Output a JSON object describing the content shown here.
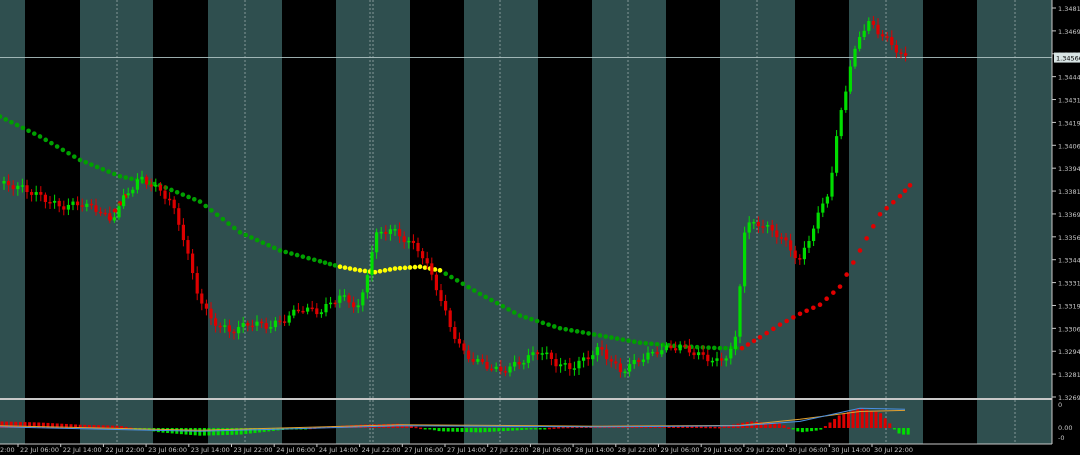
{
  "chart_data": {
    "type": "candlestick",
    "title": "",
    "price_axis": {
      "ticks": [
        "1.34815",
        "1.34690",
        "1.34565",
        "1.34440",
        "1.34315",
        "1.34190",
        "1.34065",
        "1.33940",
        "1.33815",
        "1.33690",
        "1.33565",
        "1.33440",
        "1.33315",
        "1.33190",
        "1.33065",
        "1.32940",
        "1.32815",
        "1.32690"
      ],
      "ylim": [
        1.3269,
        1.3484
      ],
      "current_price": "1.34566"
    },
    "time_axis": {
      "labels": [
        "22 Jul 06:00",
        "22 Jul 14:00",
        "22 Jul 22:00",
        "23 Jul 06:00",
        "23 Jul 14:00",
        "23 Jul 22:00",
        "24 Jul 06:00",
        "24 Jul 14:00",
        "24 Jul 22:00",
        "27 Jul 06:00",
        "27 Jul 14:00",
        "27 Jul 22:00",
        "28 Jul 06:00",
        "28 Jul 14:00",
        "28 Jul 22:00",
        "29 Jul 06:00",
        "29 Jul 14:00",
        "29 Jul 22:00",
        "30 Jul 06:00",
        "30 Jul 14:00",
        "30 Jul 22:00"
      ],
      "partial_label": "2:00"
    },
    "price_points": [
      [
        0,
        1.3387
      ],
      [
        20,
        1.3385
      ],
      [
        40,
        1.338
      ],
      [
        60,
        1.3374
      ],
      [
        80,
        1.3376
      ],
      [
        100,
        1.3372
      ],
      [
        110,
        1.3366
      ],
      [
        125,
        1.338
      ],
      [
        140,
        1.339
      ],
      [
        155,
        1.3385
      ],
      [
        170,
        1.3378
      ],
      [
        185,
        1.3355
      ],
      [
        195,
        1.333
      ],
      [
        210,
        1.3312
      ],
      [
        230,
        1.3305
      ],
      [
        250,
        1.331
      ],
      [
        270,
        1.3308
      ],
      [
        285,
        1.3312
      ],
      [
        300,
        1.3318
      ],
      [
        320,
        1.3316
      ],
      [
        340,
        1.3325
      ],
      [
        360,
        1.3318
      ],
      [
        375,
        1.3358
      ],
      [
        390,
        1.3362
      ],
      [
        405,
        1.3356
      ],
      [
        420,
        1.335
      ],
      [
        435,
        1.3332
      ],
      [
        450,
        1.3308
      ],
      [
        465,
        1.3292
      ],
      [
        480,
        1.3288
      ],
      [
        500,
        1.3283
      ],
      [
        520,
        1.3288
      ],
      [
        540,
        1.3295
      ],
      [
        555,
        1.3288
      ],
      [
        570,
        1.3285
      ],
      [
        585,
        1.329
      ],
      [
        600,
        1.3296
      ],
      [
        620,
        1.3283
      ],
      [
        640,
        1.329
      ],
      [
        660,
        1.3295
      ],
      [
        680,
        1.3297
      ],
      [
        700,
        1.3292
      ],
      [
        720,
        1.3288
      ],
      [
        735,
        1.3298
      ],
      [
        745,
        1.3364
      ],
      [
        760,
        1.3365
      ],
      [
        780,
        1.3358
      ],
      [
        800,
        1.3344
      ],
      [
        815,
        1.3365
      ],
      [
        830,
        1.3385
      ],
      [
        840,
        1.3425
      ],
      [
        850,
        1.345
      ],
      [
        860,
        1.347
      ],
      [
        870,
        1.3476
      ],
      [
        880,
        1.347
      ],
      [
        895,
        1.3462
      ],
      [
        905,
        1.3456
      ]
    ],
    "candle_bias": [
      0,
      1,
      0,
      0,
      1,
      1,
      0,
      1,
      0,
      0,
      1,
      0,
      1,
      1,
      0,
      0,
      1,
      0,
      1,
      1,
      0,
      1,
      0,
      0,
      1,
      1,
      0,
      1,
      0,
      1,
      0,
      0,
      1,
      0,
      1,
      1,
      0,
      0,
      1,
      0,
      1,
      0,
      1,
      1,
      0,
      1,
      0,
      0,
      1,
      0,
      1,
      1,
      0,
      0,
      1,
      0,
      1,
      0,
      0,
      1,
      1,
      0,
      1,
      0,
      1,
      0,
      0,
      1,
      1,
      0,
      1,
      0,
      1,
      0,
      0,
      1,
      0,
      1,
      1,
      0,
      1,
      0,
      0,
      1,
      1,
      0,
      1,
      0,
      1,
      0,
      0,
      1,
      1,
      0,
      1,
      0,
      1,
      1,
      0,
      0
    ],
    "moving_average_green": [
      [
        0,
        1.3424
      ],
      [
        40,
        1.3413
      ],
      [
        80,
        1.34
      ],
      [
        120,
        1.3391
      ],
      [
        160,
        1.3386
      ],
      [
        200,
        1.3377
      ],
      [
        240,
        1.336
      ],
      [
        280,
        1.335
      ],
      [
        320,
        1.3344
      ],
      [
        340,
        1.3341
      ]
    ],
    "moving_average_yellow": [
      [
        340,
        1.3341
      ],
      [
        360,
        1.3339
      ],
      [
        375,
        1.3338
      ],
      [
        395,
        1.334
      ],
      [
        420,
        1.3341
      ],
      [
        440,
        1.3339
      ]
    ],
    "moving_average_green_2": [
      [
        440,
        1.3339
      ],
      [
        480,
        1.3326
      ],
      [
        520,
        1.3314
      ],
      [
        560,
        1.3307
      ],
      [
        600,
        1.3303
      ],
      [
        640,
        1.3299
      ],
      [
        680,
        1.3297
      ],
      [
        720,
        1.3296
      ],
      [
        742,
        1.3296
      ]
    ],
    "sar_red": [
      [
        742,
        1.3296
      ],
      [
        760,
        1.3302
      ],
      [
        780,
        1.3309
      ],
      [
        800,
        1.3315
      ],
      [
        820,
        1.332
      ],
      [
        840,
        1.333
      ],
      [
        860,
        1.335
      ],
      [
        880,
        1.337
      ],
      [
        900,
        1.338
      ],
      [
        910,
        1.3386
      ]
    ],
    "sar_red_early": [
      [
        110,
        1.3368
      ],
      [
        125,
        1.338
      ]
    ],
    "oscillator": {
      "labels": [
        "0",
        "0.00",
        "-0"
      ],
      "histogram": [
        [
          0,
          0.3
        ],
        [
          40,
          0.25
        ],
        [
          80,
          0.15
        ],
        [
          120,
          0.1
        ],
        [
          160,
          -0.2
        ],
        [
          200,
          -0.35
        ],
        [
          240,
          -0.3
        ],
        [
          280,
          -0.1
        ],
        [
          320,
          0.05
        ],
        [
          360,
          0.15
        ],
        [
          400,
          0.2
        ],
        [
          440,
          -0.15
        ],
        [
          480,
          -0.2
        ],
        [
          520,
          -0.1
        ],
        [
          560,
          0.05
        ],
        [
          600,
          0.1
        ],
        [
          640,
          0.12
        ],
        [
          680,
          0.08
        ],
        [
          720,
          0.05
        ],
        [
          750,
          0.3
        ],
        [
          780,
          0.2
        ],
        [
          800,
          -0.2
        ],
        [
          820,
          -0.1
        ],
        [
          840,
          0.6
        ],
        [
          860,
          0.9
        ],
        [
          880,
          0.7
        ],
        [
          900,
          -0.3
        ]
      ],
      "signal_blue": [
        [
          0,
          0.05
        ],
        [
          200,
          -0.15
        ],
        [
          400,
          0.1
        ],
        [
          600,
          0.05
        ],
        [
          740,
          0.1
        ],
        [
          800,
          0.3
        ],
        [
          860,
          0.9
        ],
        [
          905,
          0.85
        ]
      ],
      "signal_orange": [
        [
          0,
          0.1
        ],
        [
          200,
          -0.1
        ],
        [
          400,
          0.15
        ],
        [
          600,
          0.08
        ],
        [
          740,
          0.12
        ],
        [
          800,
          0.4
        ],
        [
          860,
          0.75
        ],
        [
          905,
          0.8
        ]
      ]
    },
    "colors": {
      "background": "#000000",
      "band_alt": "#2f4f4f",
      "bull": "#00dd00",
      "bear": "#dd0000",
      "ma_green": "#00a000",
      "ma_yellow": "#ffff00",
      "sar_red": "#e00000",
      "axis_text": "#c8c8c8",
      "grid": "#9aaaaa",
      "price_line": "#b0c4c4",
      "osc_blue": "#4a90e2",
      "osc_orange": "#e0a030"
    }
  }
}
